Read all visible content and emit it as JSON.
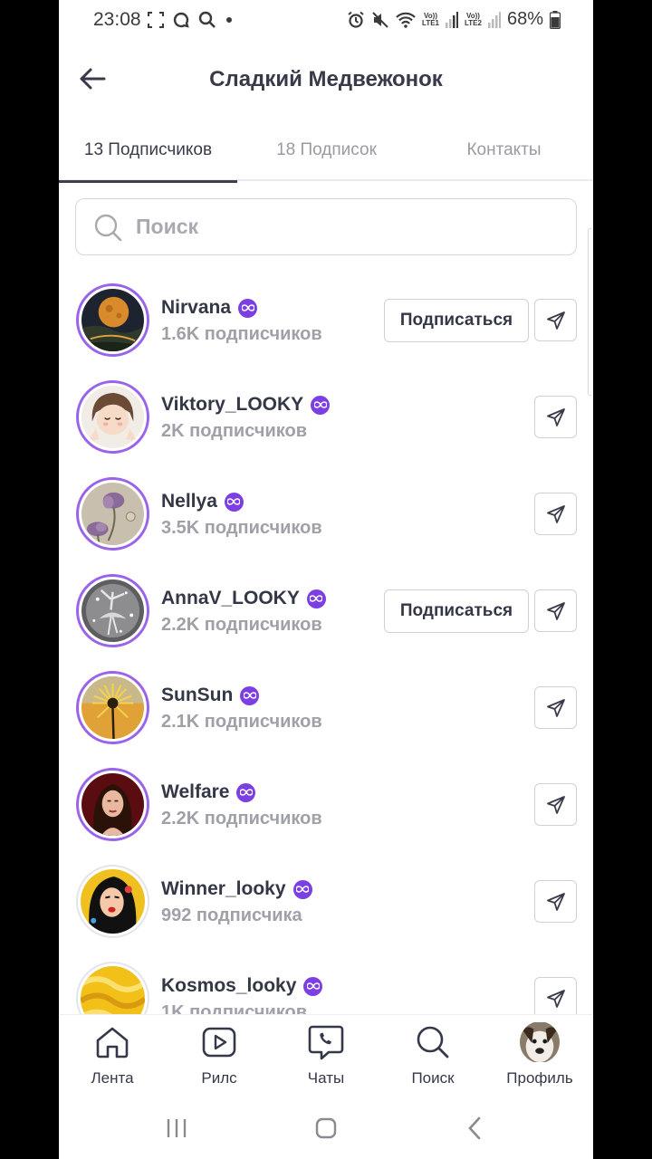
{
  "status_bar": {
    "time": "23:08",
    "battery": "68%",
    "sim1": [
      "Vo))",
      "LTE1"
    ],
    "sim2": [
      "Vo))",
      "LTE2"
    ]
  },
  "header": {
    "title": "Сладкий Медвежонок",
    "back_icon": "arrow-left-icon"
  },
  "tabs": [
    {
      "label": "13 Подписчиков",
      "active": true
    },
    {
      "label": "18 Подписок",
      "active": false
    },
    {
      "label": "Контакты",
      "active": false
    }
  ],
  "search": {
    "placeholder": "Поиск",
    "value": ""
  },
  "subscribe_label": "Подписаться",
  "users": [
    {
      "name": "Nirvana",
      "followers": "1.6K подписчиков",
      "subscribe_button": true,
      "ring": true
    },
    {
      "name": "Viktory_LOOKY",
      "followers": "2K подписчиков",
      "subscribe_button": false,
      "ring": true
    },
    {
      "name": "Nellya",
      "followers": "3.5K подписчиков",
      "subscribe_button": false,
      "ring": true
    },
    {
      "name": "AnnaV_LOOKY",
      "followers": "2.2K подписчиков",
      "subscribe_button": true,
      "ring": true
    },
    {
      "name": "SunSun",
      "followers": "2.1K подписчиков",
      "subscribe_button": false,
      "ring": true
    },
    {
      "name": "Welfare",
      "followers": "2.2K подписчиков",
      "subscribe_button": false,
      "ring": true
    },
    {
      "name": "Winner_looky",
      "followers": "992 подписчика",
      "subscribe_button": false,
      "ring": false
    },
    {
      "name": "Kosmos_looky",
      "followers": "1K подписчиков",
      "subscribe_button": false,
      "ring": false
    }
  ],
  "bottom_nav": [
    {
      "label": "Лента",
      "icon": "home-icon"
    },
    {
      "label": "Рилс",
      "icon": "play-icon"
    },
    {
      "label": "Чаты",
      "icon": "chat-phone-icon"
    },
    {
      "label": "Поиск",
      "icon": "search-icon"
    },
    {
      "label": "Профиль",
      "icon": "profile-avatar"
    }
  ],
  "colors": {
    "accent": "#7b3fe4",
    "ring": "#9a64ea",
    "text": "#343746",
    "muted": "#a0a0a8"
  }
}
